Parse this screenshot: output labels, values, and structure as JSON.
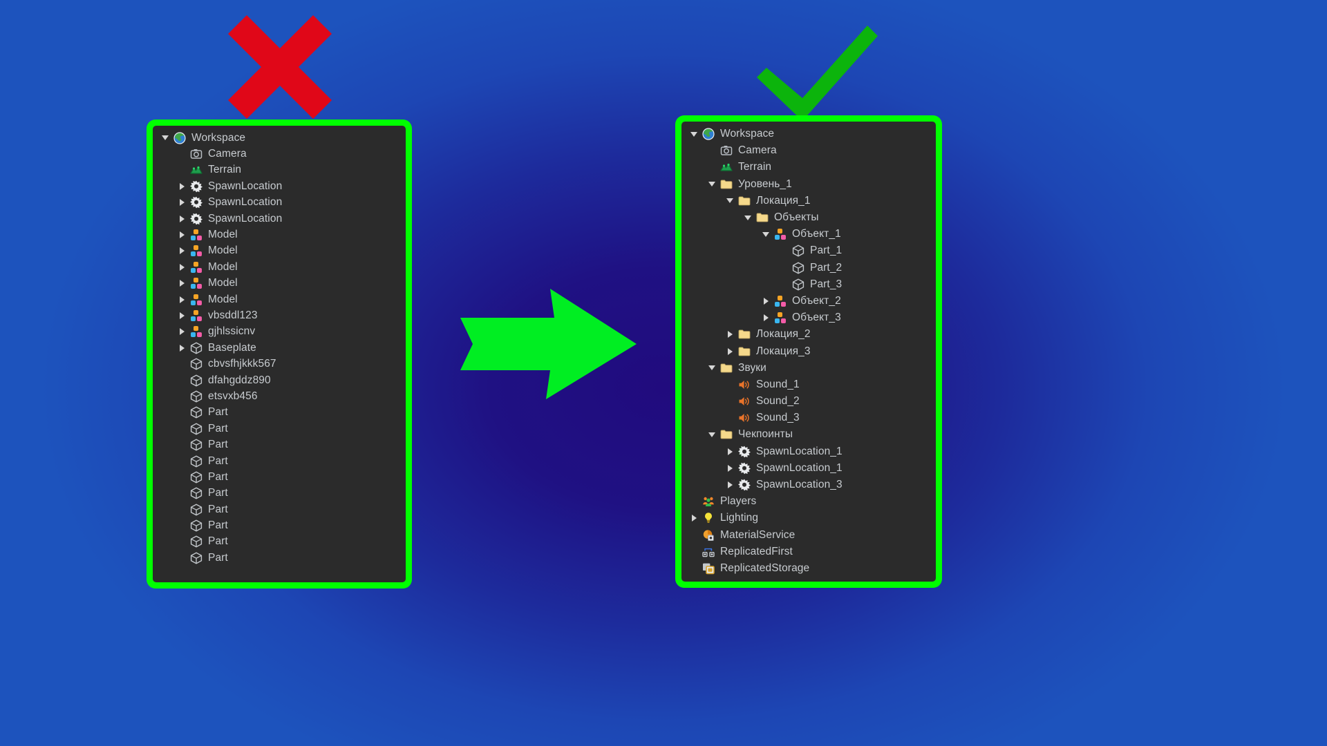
{
  "colors": {
    "panel_border": "#00ff00",
    "panel_background": "#2b2b2b",
    "text": "#c8ccd0",
    "cross": "#e00718",
    "check": "#0cb40c",
    "arrow": "#00ee22",
    "folder": "#f5d98b",
    "sound": "#e8732a",
    "model_top": "#f6a425",
    "model_left": "#39b6f0",
    "model_right": "#f45ca8"
  },
  "marks": {
    "cross": {
      "name": "red-cross-mark",
      "meaning": "wrong"
    },
    "check": {
      "name": "green-check-mark",
      "meaning": "correct"
    },
    "arrow": {
      "name": "green-right-arrow",
      "meaning": "transforms into"
    }
  },
  "bad_panel": {
    "name": "unorganized-explorer-tree",
    "rows": [
      {
        "depth": 0,
        "toggle": "open",
        "icon": "workspace-globe-icon",
        "label": "Workspace"
      },
      {
        "depth": 1,
        "toggle": "none",
        "icon": "camera-icon",
        "label": "Camera"
      },
      {
        "depth": 1,
        "toggle": "none",
        "icon": "terrain-icon",
        "label": "Terrain"
      },
      {
        "depth": 1,
        "toggle": "closed",
        "icon": "spawnlocation-icon",
        "label": "SpawnLocation"
      },
      {
        "depth": 1,
        "toggle": "closed",
        "icon": "spawnlocation-icon",
        "label": "SpawnLocation"
      },
      {
        "depth": 1,
        "toggle": "closed",
        "icon": "spawnlocation-icon",
        "label": "SpawnLocation"
      },
      {
        "depth": 1,
        "toggle": "closed",
        "icon": "model-icon",
        "label": "Model"
      },
      {
        "depth": 1,
        "toggle": "closed",
        "icon": "model-icon",
        "label": "Model"
      },
      {
        "depth": 1,
        "toggle": "closed",
        "icon": "model-icon",
        "label": "Model"
      },
      {
        "depth": 1,
        "toggle": "closed",
        "icon": "model-icon",
        "label": "Model"
      },
      {
        "depth": 1,
        "toggle": "closed",
        "icon": "model-icon",
        "label": "Model"
      },
      {
        "depth": 1,
        "toggle": "closed",
        "icon": "model-icon",
        "label": "vbsddl123"
      },
      {
        "depth": 1,
        "toggle": "closed",
        "icon": "model-icon",
        "label": "gjhlssicnv"
      },
      {
        "depth": 1,
        "toggle": "closed",
        "icon": "part-cube-icon",
        "label": "Baseplate"
      },
      {
        "depth": 1,
        "toggle": "none",
        "icon": "part-cube-icon",
        "label": "cbvsfhjkkk567"
      },
      {
        "depth": 1,
        "toggle": "none",
        "icon": "part-cube-icon",
        "label": "dfahgddz890"
      },
      {
        "depth": 1,
        "toggle": "none",
        "icon": "part-cube-icon",
        "label": "etsvxb456"
      },
      {
        "depth": 1,
        "toggle": "none",
        "icon": "part-cube-icon",
        "label": "Part"
      },
      {
        "depth": 1,
        "toggle": "none",
        "icon": "part-cube-icon",
        "label": "Part"
      },
      {
        "depth": 1,
        "toggle": "none",
        "icon": "part-cube-icon",
        "label": "Part"
      },
      {
        "depth": 1,
        "toggle": "none",
        "icon": "part-cube-icon",
        "label": "Part"
      },
      {
        "depth": 1,
        "toggle": "none",
        "icon": "part-cube-icon",
        "label": "Part"
      },
      {
        "depth": 1,
        "toggle": "none",
        "icon": "part-cube-icon",
        "label": "Part"
      },
      {
        "depth": 1,
        "toggle": "none",
        "icon": "part-cube-icon",
        "label": "Part"
      },
      {
        "depth": 1,
        "toggle": "none",
        "icon": "part-cube-icon",
        "label": "Part"
      },
      {
        "depth": 1,
        "toggle": "none",
        "icon": "part-cube-icon",
        "label": "Part"
      },
      {
        "depth": 1,
        "toggle": "none",
        "icon": "part-cube-icon",
        "label": "Part"
      }
    ]
  },
  "good_panel": {
    "name": "organized-explorer-tree",
    "rows": [
      {
        "depth": 0,
        "toggle": "open",
        "icon": "workspace-globe-icon",
        "label": "Workspace"
      },
      {
        "depth": 1,
        "toggle": "none",
        "icon": "camera-icon",
        "label": "Camera"
      },
      {
        "depth": 1,
        "toggle": "none",
        "icon": "terrain-icon",
        "label": "Terrain"
      },
      {
        "depth": 1,
        "toggle": "open",
        "icon": "folder-icon",
        "label": "Уровень_1"
      },
      {
        "depth": 2,
        "toggle": "open",
        "icon": "folder-icon",
        "label": "Локация_1"
      },
      {
        "depth": 3,
        "toggle": "open",
        "icon": "folder-icon",
        "label": "Объекты"
      },
      {
        "depth": 4,
        "toggle": "open",
        "icon": "model-icon",
        "label": "Объект_1"
      },
      {
        "depth": 5,
        "toggle": "none",
        "icon": "part-cube-icon",
        "label": "Part_1"
      },
      {
        "depth": 5,
        "toggle": "none",
        "icon": "part-cube-icon",
        "label": "Part_2"
      },
      {
        "depth": 5,
        "toggle": "none",
        "icon": "part-cube-icon",
        "label": "Part_3"
      },
      {
        "depth": 4,
        "toggle": "closed",
        "icon": "model-icon",
        "label": "Объект_2"
      },
      {
        "depth": 4,
        "toggle": "closed",
        "icon": "model-icon",
        "label": "Объект_3"
      },
      {
        "depth": 2,
        "toggle": "closed",
        "icon": "folder-icon",
        "label": "Локация_2"
      },
      {
        "depth": 2,
        "toggle": "closed",
        "icon": "folder-icon",
        "label": "Локация_3"
      },
      {
        "depth": 1,
        "toggle": "open",
        "icon": "folder-icon",
        "label": "Звуки"
      },
      {
        "depth": 2,
        "toggle": "none",
        "icon": "sound-icon",
        "label": "Sound_1"
      },
      {
        "depth": 2,
        "toggle": "none",
        "icon": "sound-icon",
        "label": "Sound_2"
      },
      {
        "depth": 2,
        "toggle": "none",
        "icon": "sound-icon",
        "label": "Sound_3"
      },
      {
        "depth": 1,
        "toggle": "open",
        "icon": "folder-icon",
        "label": "Чекпоинты"
      },
      {
        "depth": 2,
        "toggle": "closed",
        "icon": "spawnlocation-icon",
        "label": "SpawnLocation_1"
      },
      {
        "depth": 2,
        "toggle": "closed",
        "icon": "spawnlocation-icon",
        "label": "SpawnLocation_1"
      },
      {
        "depth": 2,
        "toggle": "closed",
        "icon": "spawnlocation-icon",
        "label": "SpawnLocation_3"
      },
      {
        "depth": 0,
        "toggle": "none",
        "icon": "players-icon",
        "label": "Players"
      },
      {
        "depth": 0,
        "toggle": "closed",
        "icon": "lighting-bulb-icon",
        "label": "Lighting"
      },
      {
        "depth": 0,
        "toggle": "none",
        "icon": "materialservice-icon",
        "label": "MaterialService"
      },
      {
        "depth": 0,
        "toggle": "none",
        "icon": "replicatedfirst-icon",
        "label": "ReplicatedFirst"
      },
      {
        "depth": 0,
        "toggle": "none",
        "icon": "replicatedstorage-icon",
        "label": "ReplicatedStorage"
      }
    ]
  }
}
